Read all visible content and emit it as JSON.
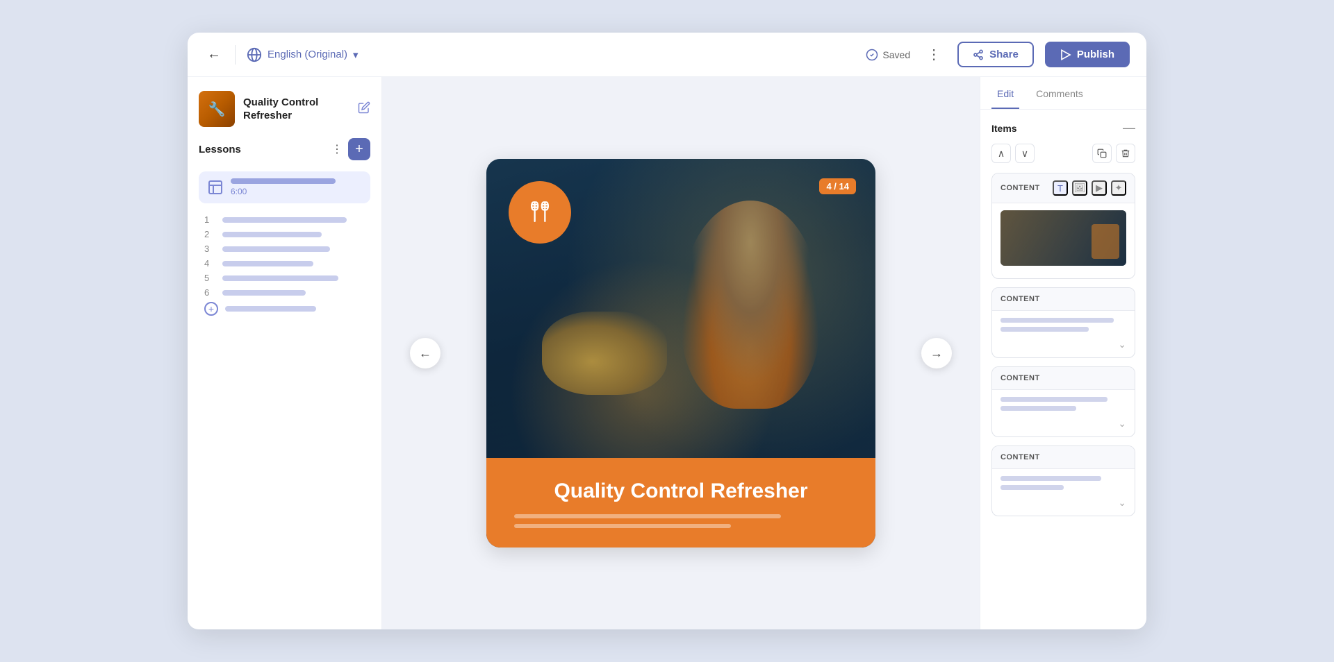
{
  "header": {
    "back_label": "←",
    "language": "English (Original)",
    "saved_label": "Saved",
    "more_label": "⋮",
    "share_label": "Share",
    "publish_label": "Publish"
  },
  "sidebar": {
    "course_title": "Quality Control Refresher",
    "lessons_label": "Lessons",
    "lesson_time": "6:00",
    "sub_lessons": [
      {
        "num": "1"
      },
      {
        "num": "2"
      },
      {
        "num": "3"
      },
      {
        "num": "4"
      },
      {
        "num": "5"
      },
      {
        "num": "6"
      }
    ]
  },
  "slide": {
    "badge": "4 / 14",
    "title": "Quality Control Refresher"
  },
  "right_panel": {
    "tab_edit": "Edit",
    "tab_comments": "Comments",
    "items_label": "Items",
    "content_cards": [
      {
        "label": "CONTENT"
      },
      {
        "label": "CONTENT"
      },
      {
        "label": "CONTENT"
      },
      {
        "label": "CONTENT"
      }
    ]
  }
}
